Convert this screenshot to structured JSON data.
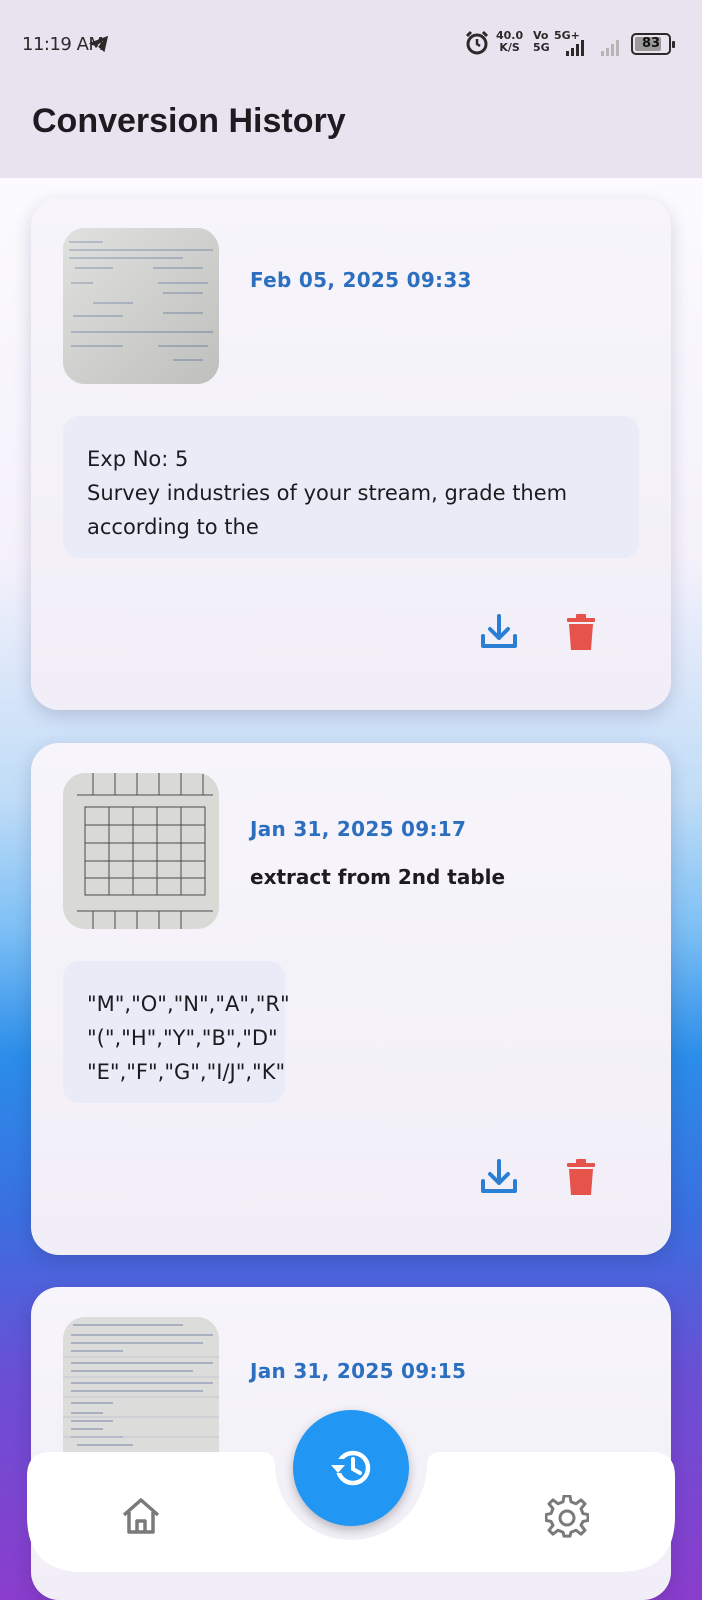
{
  "status_bar": {
    "time": "11:19 AM",
    "net_speed_value": "40.0",
    "net_speed_unit": "K/S",
    "vo_top": "Vo",
    "vo_bottom": "5G",
    "network_type": "5G+",
    "battery": "83",
    "battery_level": 0.83
  },
  "app_bar": {
    "title": "Conversion History"
  },
  "history": [
    {
      "date": "Feb 05, 2025 09:33",
      "prompt": "",
      "text_lines": [
        "Exp No: 5",
        "Survey industries of your stream, grade them",
        "according to the"
      ]
    },
    {
      "date": "Jan 31, 2025 09:17",
      "prompt": "extract from 2nd table",
      "text_lines": [
        "\"M\",\"O\",\"N\",\"A\",\"R\"",
        "\"(\",\"H\",\"Y\",\"B\",\"D\"",
        "\"E\",\"F\",\"G\",\"I/J\",\"K\""
      ]
    },
    {
      "date": "Jan 31, 2025 09:15",
      "prompt": "",
      "text_lines": []
    }
  ],
  "icons": {
    "download": "download-icon",
    "delete": "trash-icon",
    "history": "history-icon",
    "home": "home-icon",
    "settings": "gear-icon"
  },
  "colors": {
    "accent": "#2196f3",
    "date": "#2d6fbf",
    "delete": "#e5534b",
    "download": "#2a7fd4"
  }
}
